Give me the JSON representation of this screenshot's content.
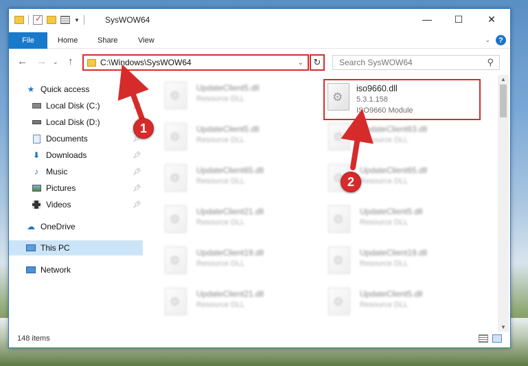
{
  "window": {
    "title": "SysWOW64"
  },
  "ribbon": {
    "tabs": [
      "File",
      "Home",
      "Share",
      "View"
    ]
  },
  "address": {
    "path": "C:\\Windows\\SysWOW64"
  },
  "search": {
    "placeholder": "Search SysWOW64"
  },
  "sidebar": {
    "items": [
      {
        "label": "Quick access",
        "icon": "star-icon"
      },
      {
        "label": "Local Disk (C:)",
        "icon": "disk-icon",
        "pinned": true
      },
      {
        "label": "Local Disk (D:)",
        "icon": "disk-icon",
        "pinned": true
      },
      {
        "label": "Documents",
        "icon": "documents-icon",
        "pinned": true
      },
      {
        "label": "Downloads",
        "icon": "download-icon",
        "pinned": true
      },
      {
        "label": "Music",
        "icon": "music-icon",
        "pinned": true
      },
      {
        "label": "Pictures",
        "icon": "pictures-icon",
        "pinned": true
      },
      {
        "label": "Videos",
        "icon": "videos-icon",
        "pinned": true
      },
      {
        "label": "OneDrive",
        "icon": "cloud-icon"
      },
      {
        "label": "This PC",
        "icon": "computer-icon",
        "selected": true
      },
      {
        "label": "Network",
        "icon": "network-icon"
      }
    ]
  },
  "files": {
    "highlighted": {
      "name": "iso9660.dll",
      "version": "5.3.1.158",
      "description": "ISO9660 Module"
    },
    "left_column": [
      {
        "name": "UpdateClient5.dll",
        "type": "Resource DLL"
      },
      {
        "name": "UpdateClient5.dll",
        "type": "Resource DLL"
      },
      {
        "name": "UpdateClient65.dll",
        "type": "Resource DLL"
      },
      {
        "name": "UpdateClient21.dll",
        "type": "Resource DLL"
      },
      {
        "name": "UpdateClient19.dll",
        "type": "Resource DLL"
      },
      {
        "name": "UpdateClient21.dll",
        "type": "Resource DLL"
      }
    ],
    "right_column": [
      {
        "name": "UpdateClient63.dll",
        "type": "Resource DLL"
      },
      {
        "name": "UpdateClient65.dll",
        "type": "Resource DLL"
      },
      {
        "name": "UpdateClient5.dll",
        "type": "Resource DLL"
      },
      {
        "name": "UpdateClient19.dll",
        "type": "Resource DLL"
      },
      {
        "name": "UpdateClient5.dll",
        "type": "Resource DLL"
      }
    ]
  },
  "status": {
    "item_count": "148 items"
  },
  "annotations": {
    "callout_1": "1",
    "callout_2": "2",
    "color": "#d62b2b"
  }
}
